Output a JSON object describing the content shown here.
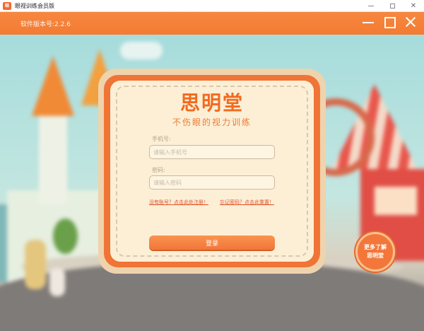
{
  "window": {
    "title": "眼视训练会员版",
    "app_icon_text": "眼"
  },
  "header": {
    "version": "软件版本号:2.2.6"
  },
  "login": {
    "brand_title": "思明堂",
    "brand_subtitle": "不伤眼的视力训练",
    "phone_label": "手机号:",
    "phone_placeholder": "请输入手机号",
    "password_label": "密码:",
    "password_placeholder": "请输入密码",
    "register_link": "没有账号？点击此处注册！",
    "forgot_link": "忘记密码？点击此重置！",
    "login_button": "登录"
  },
  "learn_more": {
    "line1": "更多了解",
    "line2": "思明堂"
  },
  "colors": {
    "accent": "#f37b33",
    "brand": "#f26a1e",
    "link": "#e3522a",
    "card": "#fcefd6"
  }
}
